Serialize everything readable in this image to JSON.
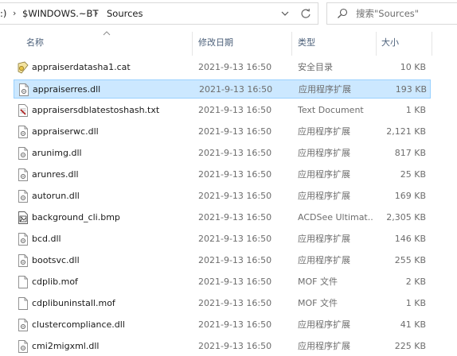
{
  "address": {
    "segments": [
      ":)",
      "$WINDOWS.~BT",
      "Sources"
    ],
    "separator": "›"
  },
  "search": {
    "placeholder": "搜索\"Sources\""
  },
  "columns": {
    "name": "名称",
    "date": "修改日期",
    "type": "类型",
    "size": "大小"
  },
  "files": [
    {
      "name": "appraiserdatasha1.cat",
      "date": "2021-9-13 16:50",
      "type": "安全目录",
      "size": "10 KB",
      "icon": "catalog-file-icon",
      "selected": false
    },
    {
      "name": "appraiserres.dll",
      "date": "2021-9-13 16:50",
      "type": "应用程序扩展",
      "size": "193 KB",
      "icon": "dll-file-icon",
      "selected": true
    },
    {
      "name": "appraisersdblatestoshash.txt",
      "date": "2021-9-13 16:50",
      "type": "Text Document",
      "size": "1 KB",
      "icon": "text-file-icon",
      "selected": false
    },
    {
      "name": "appraiserwc.dll",
      "date": "2021-9-13 16:50",
      "type": "应用程序扩展",
      "size": "2,121 KB",
      "icon": "dll-file-icon",
      "selected": false
    },
    {
      "name": "arunimg.dll",
      "date": "2021-9-13 16:50",
      "type": "应用程序扩展",
      "size": "817 KB",
      "icon": "dll-file-icon",
      "selected": false
    },
    {
      "name": "arunres.dll",
      "date": "2021-9-13 16:50",
      "type": "应用程序扩展",
      "size": "25 KB",
      "icon": "dll-file-icon",
      "selected": false
    },
    {
      "name": "autorun.dll",
      "date": "2021-9-13 16:50",
      "type": "应用程序扩展",
      "size": "169 KB",
      "icon": "dll-file-icon",
      "selected": false
    },
    {
      "name": "background_cli.bmp",
      "date": "2021-9-13 16:50",
      "type": "ACDSee Ultimat...",
      "size": "2,305 KB",
      "icon": "image-file-icon",
      "selected": false
    },
    {
      "name": "bcd.dll",
      "date": "2021-9-13 16:50",
      "type": "应用程序扩展",
      "size": "146 KB",
      "icon": "dll-file-icon",
      "selected": false
    },
    {
      "name": "bootsvc.dll",
      "date": "2021-9-13 16:50",
      "type": "应用程序扩展",
      "size": "255 KB",
      "icon": "dll-file-icon",
      "selected": false
    },
    {
      "name": "cdplib.mof",
      "date": "2021-9-13 16:50",
      "type": "MOF 文件",
      "size": "2 KB",
      "icon": "blank-file-icon",
      "selected": false
    },
    {
      "name": "cdplibuninstall.mof",
      "date": "2021-9-13 16:50",
      "type": "MOF 文件",
      "size": "1 KB",
      "icon": "blank-file-icon",
      "selected": false
    },
    {
      "name": "clustercompliance.dll",
      "date": "2021-9-13 16:50",
      "type": "应用程序扩展",
      "size": "41 KB",
      "icon": "dll-file-icon",
      "selected": false
    },
    {
      "name": "cmi2migxml.dll",
      "date": "2021-9-13 16:50",
      "type": "应用程序扩展",
      "size": "225 KB",
      "icon": "dll-file-icon",
      "selected": false
    }
  ],
  "colors": {
    "selected_bg": "#cce8ff",
    "selected_border": "#99d1ff",
    "header_text": "#4c607a",
    "meta_text": "#6d6d6d"
  }
}
